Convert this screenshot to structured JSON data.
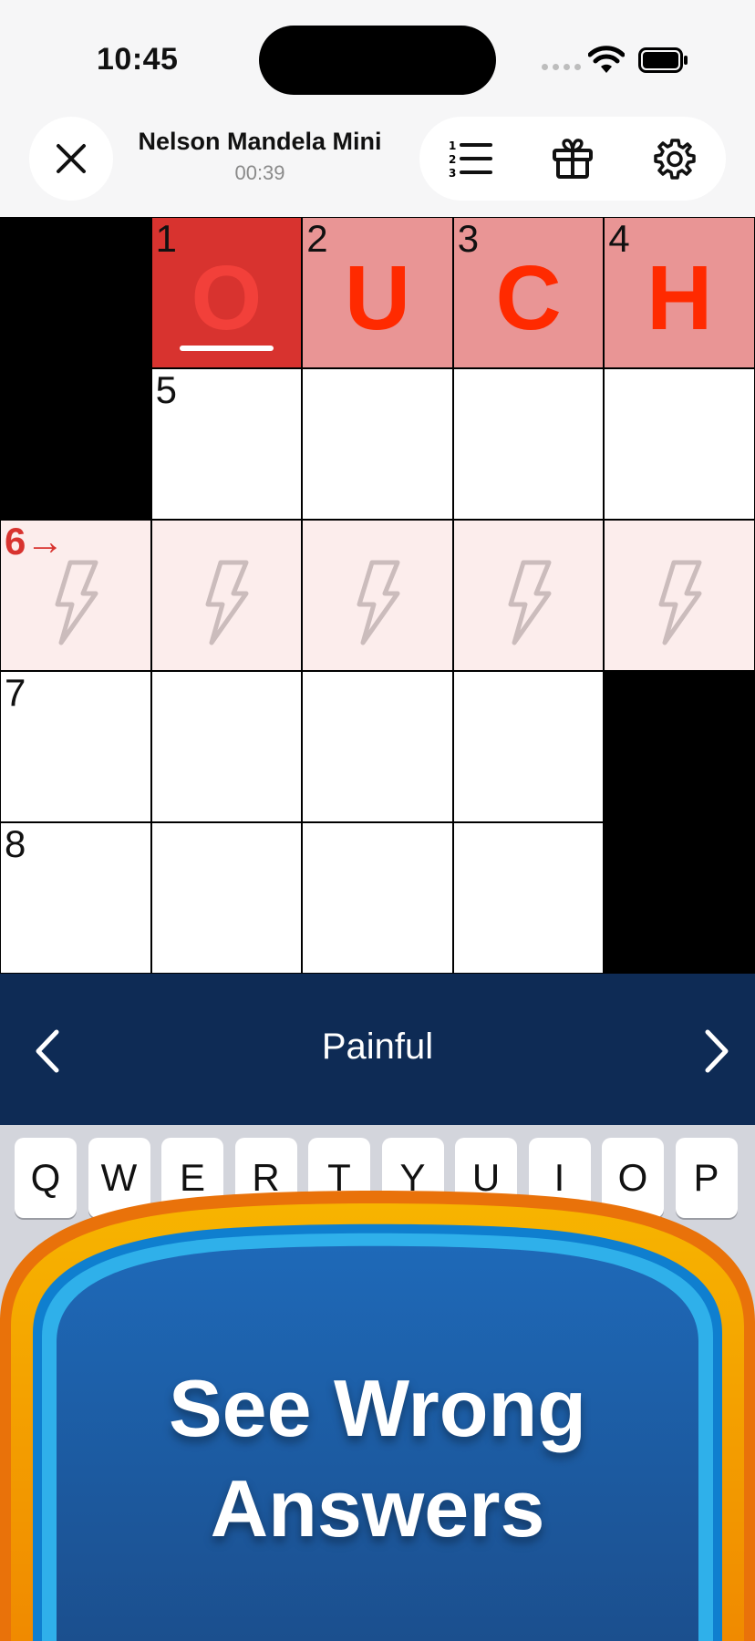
{
  "status_bar": {
    "time": "10:45"
  },
  "header": {
    "title": "Nelson Mandela Mini",
    "timer": "00:39",
    "icons": {
      "close": "close-icon",
      "clues": "numbered-list-icon",
      "gift": "gift-icon",
      "settings": "gear-icon"
    }
  },
  "grid": {
    "rows": 5,
    "cols": 5,
    "cells": [
      [
        {
          "type": "block"
        },
        {
          "type": "active",
          "number": "1",
          "letter": "O"
        },
        {
          "type": "word",
          "number": "2",
          "letter": "U"
        },
        {
          "type": "word",
          "number": "3",
          "letter": "C"
        },
        {
          "type": "word",
          "number": "4",
          "letter": "H"
        }
      ],
      [
        {
          "type": "block"
        },
        {
          "type": "open",
          "number": "5"
        },
        {
          "type": "open"
        },
        {
          "type": "open"
        },
        {
          "type": "open"
        }
      ],
      [
        {
          "type": "rowhl",
          "number": "6→",
          "bolt": true
        },
        {
          "type": "rowhl",
          "bolt": true
        },
        {
          "type": "rowhl",
          "bolt": true
        },
        {
          "type": "rowhl",
          "bolt": true
        },
        {
          "type": "rowhl",
          "bolt": true
        }
      ],
      [
        {
          "type": "open",
          "number": "7"
        },
        {
          "type": "open"
        },
        {
          "type": "open"
        },
        {
          "type": "open"
        },
        {
          "type": "block"
        }
      ],
      [
        {
          "type": "open",
          "number": "8"
        },
        {
          "type": "open"
        },
        {
          "type": "open"
        },
        {
          "type": "open"
        },
        {
          "type": "block"
        }
      ]
    ]
  },
  "clue": {
    "text": "Painful"
  },
  "keyboard": {
    "row1": [
      "Q",
      "W",
      "E",
      "R",
      "T",
      "Y",
      "U",
      "I",
      "O",
      "P"
    ]
  },
  "promo": {
    "line1": "See Wrong",
    "line2": "Answers"
  },
  "colors": {
    "active_cell": "#d8332f",
    "word_cell": "#e99595",
    "row_highlight": "#fcedec",
    "letter": "#ff2a00",
    "clue_bar": "#0e2b55",
    "promo_blue": "#1d5fa8",
    "promo_orange": "#f5a20a"
  }
}
